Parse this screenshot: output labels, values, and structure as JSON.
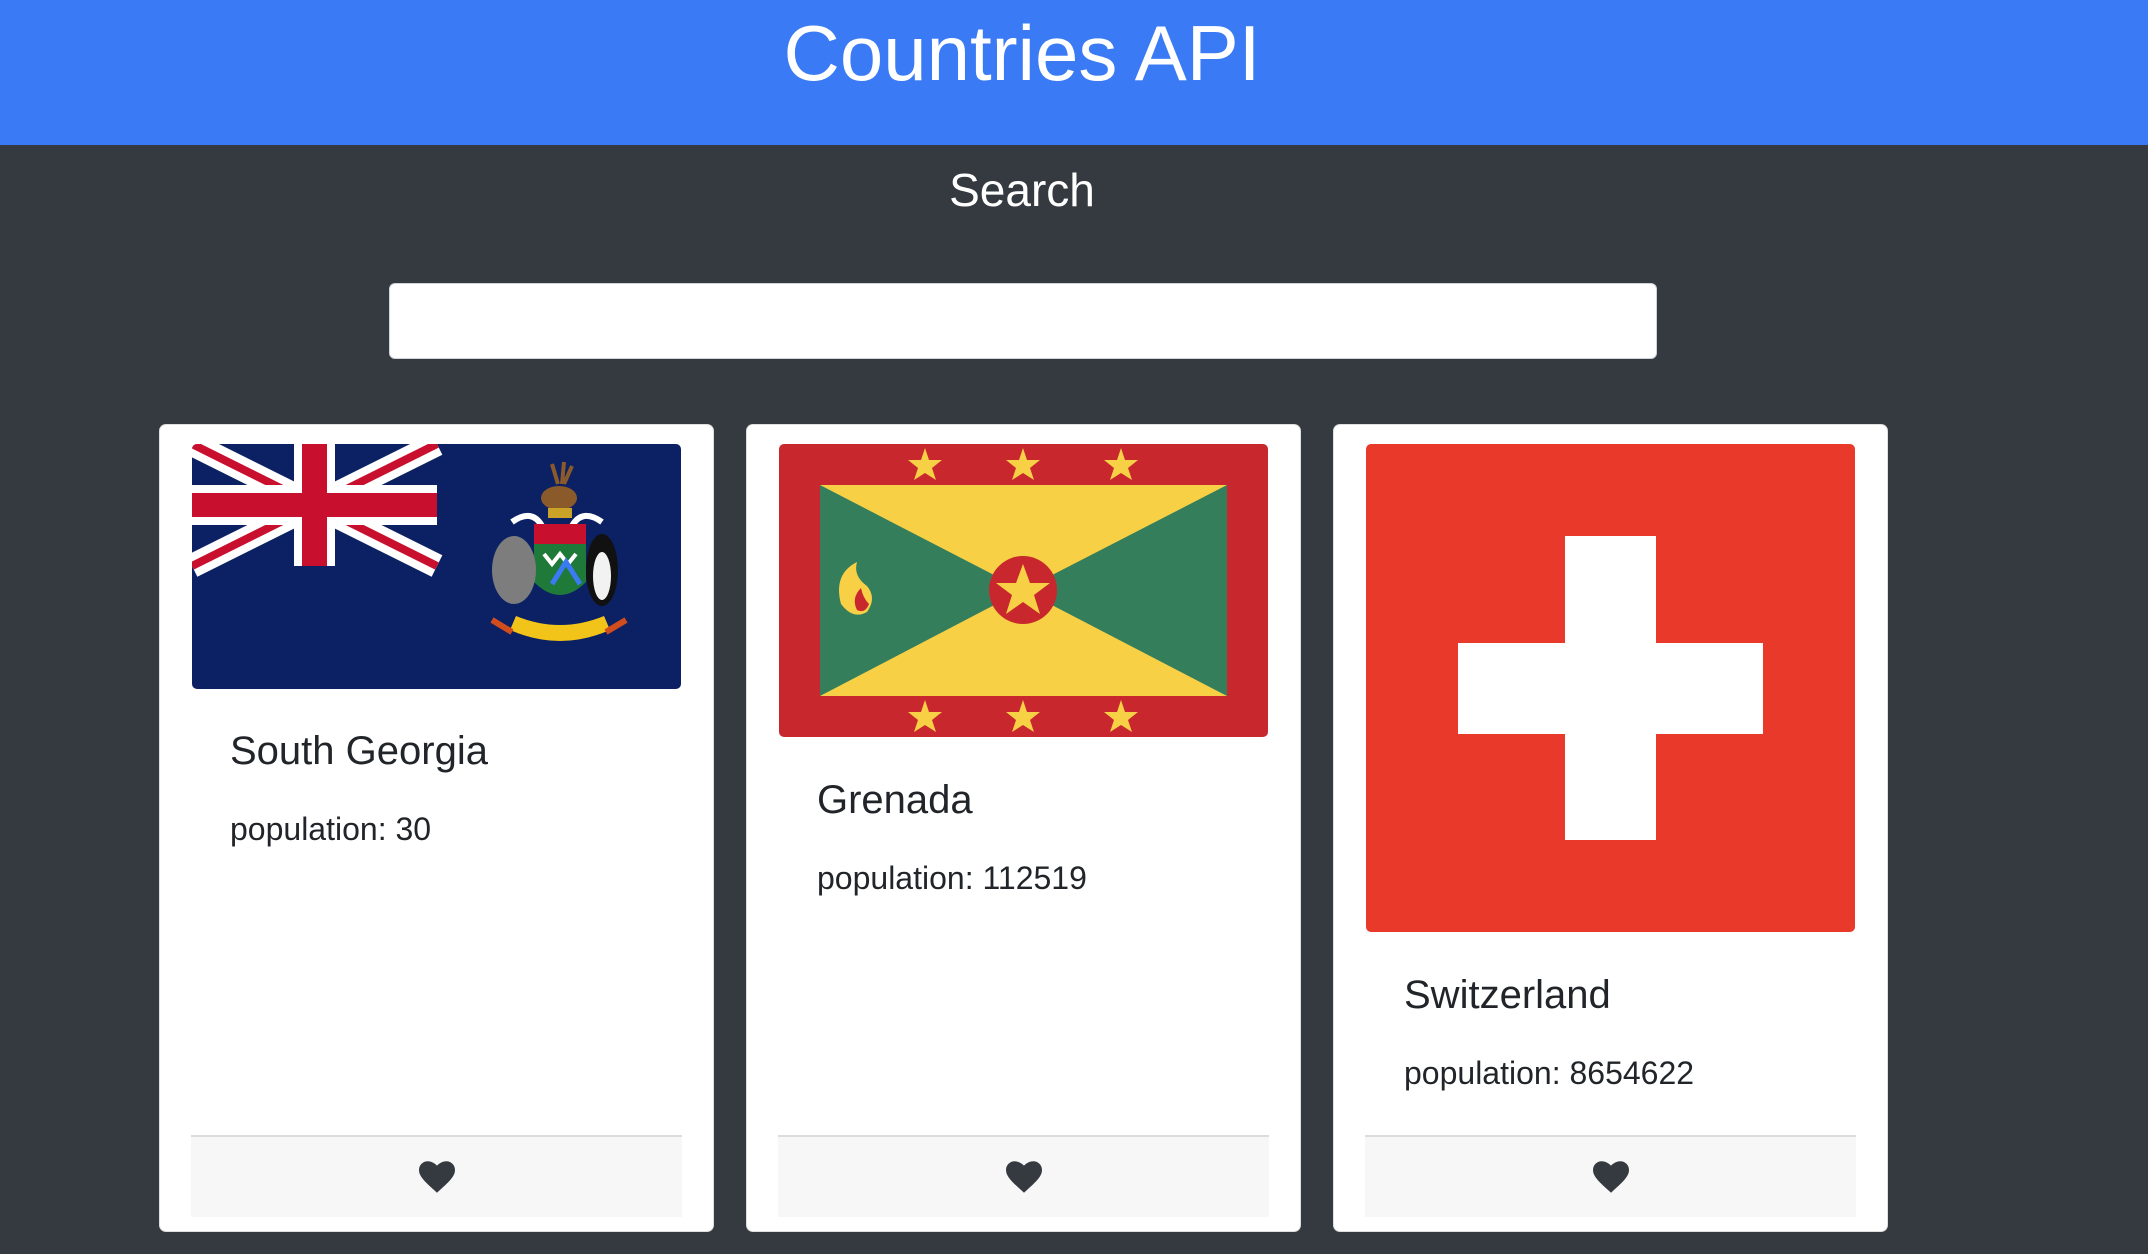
{
  "header": {
    "title": "Countries API"
  },
  "search": {
    "label": "Search",
    "value": "",
    "placeholder": ""
  },
  "cards": [
    {
      "name": "South Georgia",
      "population": "population: 30",
      "flag_icon": "south-georgia-flag"
    },
    {
      "name": "Grenada",
      "population": "population: 112519",
      "flag_icon": "grenada-flag"
    },
    {
      "name": "Switzerland",
      "population": "population: 8654622",
      "flag_icon": "switzerland-flag"
    }
  ],
  "colors": {
    "header_bg": "#3a7bf5",
    "page_bg": "#343a40",
    "card_bg": "#ffffff",
    "footer_bg": "#f7f7f7",
    "heart": "#343a40"
  }
}
